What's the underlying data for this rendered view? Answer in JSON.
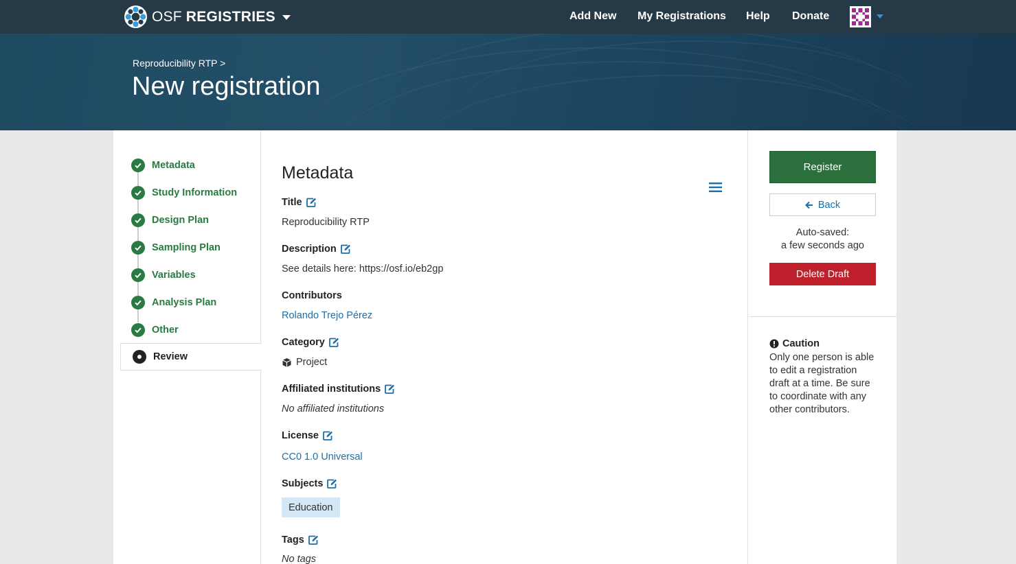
{
  "navbar": {
    "brand_osf": "OSF",
    "brand_registries": "REGISTRIES",
    "links": {
      "add_new": "Add New",
      "my_registrations": "My Registrations",
      "help": "Help",
      "donate": "Donate"
    }
  },
  "hero": {
    "breadcrumb": "Reproducibility RTP >",
    "title": "New registration"
  },
  "steps": [
    {
      "label": "Metadata",
      "status": "complete"
    },
    {
      "label": "Study Information",
      "status": "complete"
    },
    {
      "label": "Design Plan",
      "status": "complete"
    },
    {
      "label": "Sampling Plan",
      "status": "complete"
    },
    {
      "label": "Variables",
      "status": "complete"
    },
    {
      "label": "Analysis Plan",
      "status": "complete"
    },
    {
      "label": "Other",
      "status": "complete"
    },
    {
      "label": "Review",
      "status": "current"
    }
  ],
  "content": {
    "section_title": "Metadata",
    "fields": {
      "title": {
        "label": "Title",
        "value": "Reproducibility RTP"
      },
      "description": {
        "label": "Description",
        "value": "See details here: https://osf.io/eb2gp"
      },
      "contributors": {
        "label": "Contributors",
        "value": "Rolando Trejo Pérez"
      },
      "category": {
        "label": "Category",
        "value": "Project"
      },
      "affiliated": {
        "label": "Affiliated institutions",
        "value": "No affiliated institutions"
      },
      "license": {
        "label": "License",
        "value": "CC0 1.0 Universal"
      },
      "subjects": {
        "label": "Subjects",
        "value": "Education"
      },
      "tags": {
        "label": "Tags",
        "value": "No tags"
      }
    }
  },
  "sidebar_right": {
    "register_label": "Register",
    "back_label": "Back",
    "autosave_line1": "Auto-saved:",
    "autosave_line2": "a few seconds ago",
    "delete_label": "Delete Draft",
    "caution_title": "Caution",
    "caution_text": "Only one person is able to edit a registration draft at a time. Be sure to coordinate with any other contributors."
  },
  "colors": {
    "navbar_bg": "#263947",
    "success_green": "#2a7a43",
    "register_green": "#2a6f3c",
    "link_blue": "#1b6fa8",
    "danger_red": "#c0202b",
    "subject_tag_bg": "#d3e7f5"
  },
  "icons": {
    "edit": "edit-icon",
    "check": "check-circle-icon",
    "menu": "hamburger-menu-icon",
    "back": "arrow-left-icon",
    "caution": "exclamation-circle-icon",
    "category": "cube-icon"
  }
}
